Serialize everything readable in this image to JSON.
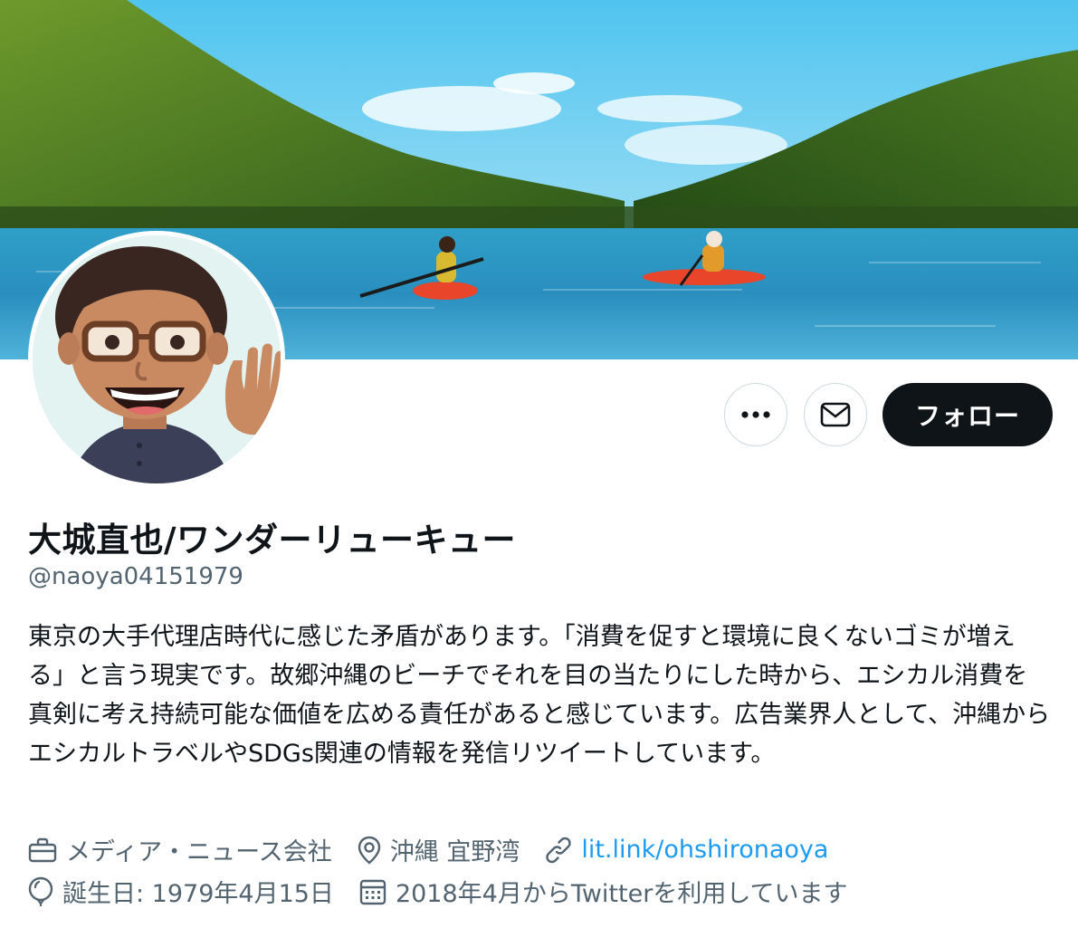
{
  "profile": {
    "display_name": "大城直也/ワンダーリューキュー",
    "handle": "@naoya04151979",
    "bio": "東京の大手代理店時代に感じた矛盾があります。「消費を促すと環境に良くないゴミが増える」と言う現実です。故郷沖縄のビーチでそれを目の当たりにした時から、エシカル消費を真剣に考え持続可能な価値を広める責任があると感じています。広告業界人として、沖縄からエシカルトラベルやSDGs関連の情報を発信リツイートしています。",
    "category": "メディア・ニュース会社",
    "location": "沖縄 宜野湾",
    "link": "lit.link/ohshironaoya",
    "birthday": "誕生日: 1979年4月15日",
    "joined": "2018年4月からTwitterを利用しています"
  },
  "actions": {
    "follow_label": "フォロー"
  },
  "icons": {
    "more": "more-icon",
    "message": "mail-icon",
    "category": "briefcase-icon",
    "location": "location-pin-icon",
    "link": "link-icon",
    "birthday": "balloon-icon",
    "joined": "calendar-icon"
  },
  "colors": {
    "follow_bg": "#0f1419",
    "link": "#1d9bf0",
    "secondary_text": "#536471"
  }
}
